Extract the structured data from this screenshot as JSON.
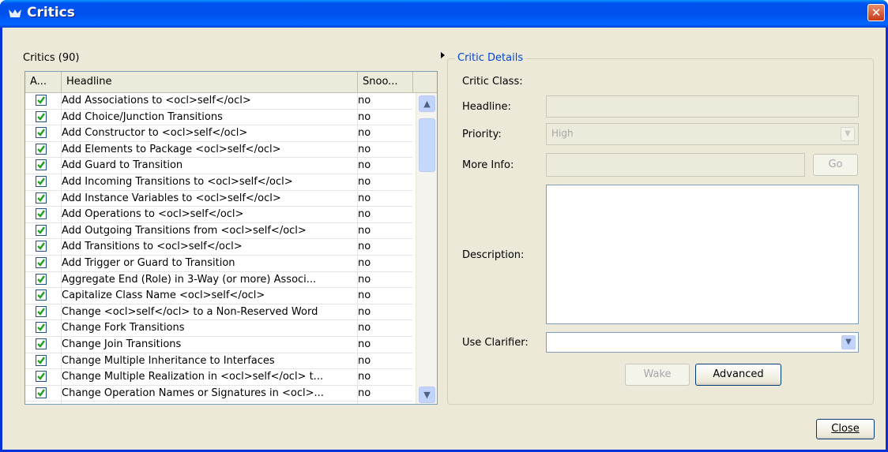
{
  "window": {
    "title": "Critics"
  },
  "critics_label": "Critics (90)",
  "table": {
    "columns": [
      "A...",
      "Headline",
      "Snoo..."
    ],
    "rows": [
      {
        "headline": "Add Associations to <ocl>self</ocl>",
        "snooze": "no",
        "active": true
      },
      {
        "headline": "Add Choice/Junction Transitions",
        "snooze": "no",
        "active": true
      },
      {
        "headline": "Add Constructor to <ocl>self</ocl>",
        "snooze": "no",
        "active": true
      },
      {
        "headline": "Add Elements to Package <ocl>self</ocl>",
        "snooze": "no",
        "active": true
      },
      {
        "headline": "Add Guard to Transition",
        "snooze": "no",
        "active": true
      },
      {
        "headline": "Add Incoming Transitions to <ocl>self</ocl>",
        "snooze": "no",
        "active": true
      },
      {
        "headline": "Add Instance Variables to <ocl>self</ocl>",
        "snooze": "no",
        "active": true
      },
      {
        "headline": "Add Operations to <ocl>self</ocl>",
        "snooze": "no",
        "active": true
      },
      {
        "headline": "Add Outgoing Transitions from <ocl>self</ocl>",
        "snooze": "no",
        "active": true
      },
      {
        "headline": "Add Transitions to <ocl>self</ocl>",
        "snooze": "no",
        "active": true
      },
      {
        "headline": "Add Trigger or Guard to Transition",
        "snooze": "no",
        "active": true
      },
      {
        "headline": "Aggregate End (Role) in 3-Way (or more) Associ...",
        "snooze": "no",
        "active": true
      },
      {
        "headline": "Capitalize Class Name <ocl>self</ocl>",
        "snooze": "no",
        "active": true
      },
      {
        "headline": "Change <ocl>self</ocl> to a Non-Reserved Word",
        "snooze": "no",
        "active": true
      },
      {
        "headline": "Change Fork Transitions",
        "snooze": "no",
        "active": true
      },
      {
        "headline": "Change Join Transitions",
        "snooze": "no",
        "active": true
      },
      {
        "headline": "Change Multiple Inheritance to Interfaces",
        "snooze": "no",
        "active": true
      },
      {
        "headline": "Change Multiple Realization in <ocl>self</ocl> t...",
        "snooze": "no",
        "active": true
      },
      {
        "headline": "Change Operation Names or Signatures in <ocl>...",
        "snooze": "no",
        "active": true
      }
    ]
  },
  "details": {
    "group_title": "Critic Details",
    "critic_class_label": "Critic Class:",
    "headline_label": "Headline:",
    "headline_value": "",
    "priority_label": "Priority:",
    "priority_value": "High",
    "more_info_label": "More Info:",
    "more_info_value": "",
    "go_label": "Go",
    "description_label": "Description:",
    "description_value": "",
    "use_clarifier_label": "Use Clarifier:",
    "use_clarifier_value": "",
    "wake_label": "Wake",
    "advanced_label": "Advanced"
  },
  "close_label": "Close",
  "colors": {
    "title_bar": "#0053ee",
    "window_bg": "#ece9d8",
    "group_title": "#0046d5",
    "check": "#21a121"
  }
}
